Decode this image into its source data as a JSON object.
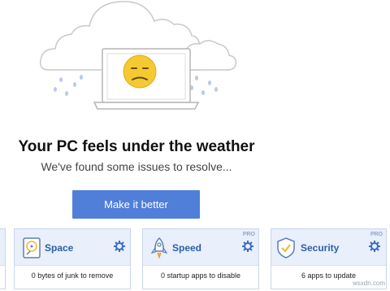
{
  "headline": "Your PC feels under the weather",
  "subline": "We've found some issues to resolve...",
  "cta_label": "Make it better",
  "cards": [
    {
      "title": "Space",
      "desc": "0 bytes of junk to remove",
      "badge": ""
    },
    {
      "title": "Speed",
      "desc": "0 startup apps to disable",
      "badge": "PRO"
    },
    {
      "title": "Security",
      "desc": "6 apps to update",
      "badge": "PRO"
    }
  ],
  "watermark": "wsxdn.com",
  "colors": {
    "accent": "#4f7fd9",
    "card_title": "#2e5ea8",
    "card_bg": "#e9effb",
    "face": "#f5c932"
  },
  "icons": [
    "cloud-icon",
    "laptop-icon",
    "sad-face-icon",
    "raindrop-icon",
    "disk-icon",
    "rocket-icon",
    "shield-icon",
    "gear-icon"
  ]
}
